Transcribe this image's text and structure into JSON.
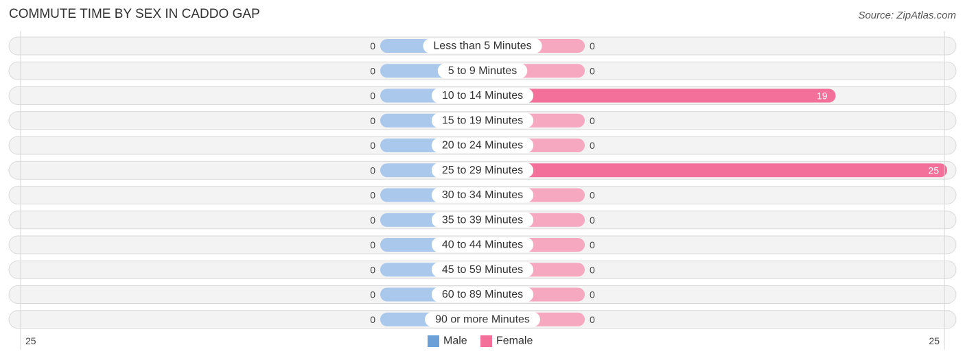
{
  "header": {
    "title": "COMMUTE TIME BY SEX IN CADDO GAP",
    "source": "Source: ZipAtlas.com"
  },
  "chart_data": {
    "type": "bar",
    "orientation": "horizontal-diverging",
    "title": "COMMUTE TIME BY SEX IN CADDO GAP",
    "categories": [
      "Less than 5 Minutes",
      "5 to 9 Minutes",
      "10 to 14 Minutes",
      "15 to 19 Minutes",
      "20 to 24 Minutes",
      "25 to 29 Minutes",
      "30 to 34 Minutes",
      "35 to 39 Minutes",
      "40 to 44 Minutes",
      "45 to 59 Minutes",
      "60 to 89 Minutes",
      "90 or more Minutes"
    ],
    "series": [
      {
        "name": "Male",
        "color": "#6a9fd8",
        "bar_color": "#a9c8ec",
        "values": [
          0,
          0,
          0,
          0,
          0,
          0,
          0,
          0,
          0,
          0,
          0,
          0
        ]
      },
      {
        "name": "Female",
        "color": "#f2709a",
        "bar_color": "#f7a8c1",
        "values": [
          0,
          0,
          19,
          0,
          0,
          25,
          0,
          0,
          0,
          0,
          0,
          0
        ]
      }
    ],
    "axis": {
      "left_label": "25",
      "right_label": "25",
      "max": 25
    },
    "legend": {
      "position": "bottom-center",
      "items": [
        "Male",
        "Female"
      ]
    },
    "grid": false
  }
}
